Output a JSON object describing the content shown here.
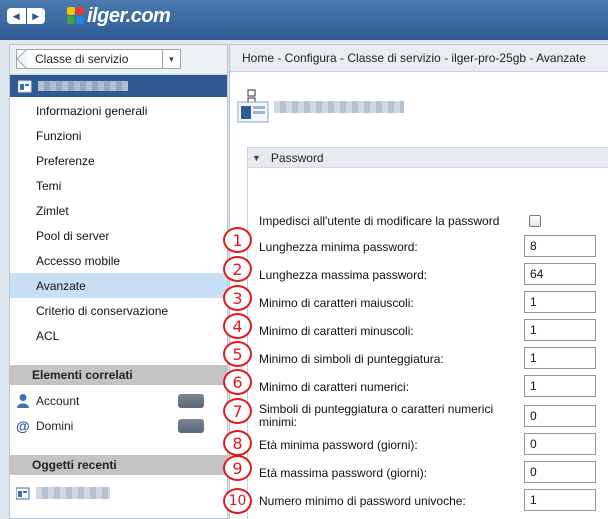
{
  "header": {
    "back_icon": "back-arrow-icon",
    "forward_icon": "forward-arrow-icon",
    "logo_text": "ilger.com"
  },
  "sidebar": {
    "cos_select": "Classe di servizio",
    "items": [
      {
        "label": "Informazioni generali",
        "active": false
      },
      {
        "label": "Funzioni",
        "active": false
      },
      {
        "label": "Preferenze",
        "active": false
      },
      {
        "label": "Temi",
        "active": false
      },
      {
        "label": "Zimlet",
        "active": false
      },
      {
        "label": "Pool di server",
        "active": false
      },
      {
        "label": "Accesso mobile",
        "active": false
      },
      {
        "label": "Avanzate",
        "active": true
      },
      {
        "label": "Criterio di conservazione",
        "active": false
      },
      {
        "label": "ACL",
        "active": false
      }
    ],
    "related_title": "Elementi correlati",
    "related": [
      {
        "label": "Account",
        "icon": "user-icon"
      },
      {
        "label": "Domini",
        "icon": "at-sign-icon"
      }
    ],
    "recent_title": "Oggetti recenti"
  },
  "main": {
    "breadcrumb": "Home - Configura - Classe di servizio - ilger-pro-25gb - Avanzate",
    "section_title": "Password",
    "checkbox_row": {
      "label": "Impedisci all'utente di modificare la password",
      "checked": false
    },
    "fields": [
      {
        "badge": "1",
        "label": "Lunghezza minima password:",
        "value": "8"
      },
      {
        "badge": "2",
        "label": "Lunghezza massima password:",
        "value": "64"
      },
      {
        "badge": "3",
        "label": "Minimo di caratteri maiuscoli:",
        "value": "1"
      },
      {
        "badge": "4",
        "label": "Minimo di caratteri minuscoli:",
        "value": "1"
      },
      {
        "badge": "5",
        "label": "Minimo di simboli di punteggiatura:",
        "value": "1"
      },
      {
        "badge": "6",
        "label": "Minimo di caratteri numerici:",
        "value": "1"
      },
      {
        "badge": "7",
        "label": "Simboli di punteggiatura o caratteri numerici minimi:",
        "value": "0"
      },
      {
        "badge": "8",
        "label": "Età minima password (giorni):",
        "value": "0"
      },
      {
        "badge": "9",
        "label": "Età massima password (giorni):",
        "value": "0"
      },
      {
        "badge": "10",
        "label": "Numero minimo di password univoche:",
        "value": "1"
      }
    ]
  },
  "colors": {
    "topbar": "#2f5a93",
    "active_item": "#c9dff5",
    "badge": "#e01b1b"
  }
}
